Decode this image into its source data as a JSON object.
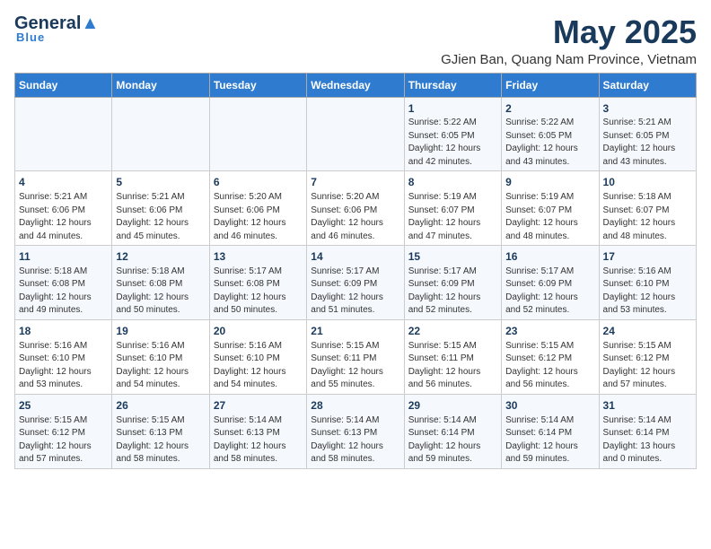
{
  "header": {
    "logo_general": "General",
    "logo_blue": "Blue",
    "logo_sub": "Blue",
    "month_title": "May 2025",
    "location": "GJien Ban, Quang Nam Province, Vietnam"
  },
  "days_of_week": [
    "Sunday",
    "Monday",
    "Tuesday",
    "Wednesday",
    "Thursday",
    "Friday",
    "Saturday"
  ],
  "weeks": [
    [
      {
        "day": "",
        "info": ""
      },
      {
        "day": "",
        "info": ""
      },
      {
        "day": "",
        "info": ""
      },
      {
        "day": "",
        "info": ""
      },
      {
        "day": "1",
        "info": "Sunrise: 5:22 AM\nSunset: 6:05 PM\nDaylight: 12 hours\nand 42 minutes."
      },
      {
        "day": "2",
        "info": "Sunrise: 5:22 AM\nSunset: 6:05 PM\nDaylight: 12 hours\nand 43 minutes."
      },
      {
        "day": "3",
        "info": "Sunrise: 5:21 AM\nSunset: 6:05 PM\nDaylight: 12 hours\nand 43 minutes."
      }
    ],
    [
      {
        "day": "4",
        "info": "Sunrise: 5:21 AM\nSunset: 6:06 PM\nDaylight: 12 hours\nand 44 minutes."
      },
      {
        "day": "5",
        "info": "Sunrise: 5:21 AM\nSunset: 6:06 PM\nDaylight: 12 hours\nand 45 minutes."
      },
      {
        "day": "6",
        "info": "Sunrise: 5:20 AM\nSunset: 6:06 PM\nDaylight: 12 hours\nand 46 minutes."
      },
      {
        "day": "7",
        "info": "Sunrise: 5:20 AM\nSunset: 6:06 PM\nDaylight: 12 hours\nand 46 minutes."
      },
      {
        "day": "8",
        "info": "Sunrise: 5:19 AM\nSunset: 6:07 PM\nDaylight: 12 hours\nand 47 minutes."
      },
      {
        "day": "9",
        "info": "Sunrise: 5:19 AM\nSunset: 6:07 PM\nDaylight: 12 hours\nand 48 minutes."
      },
      {
        "day": "10",
        "info": "Sunrise: 5:18 AM\nSunset: 6:07 PM\nDaylight: 12 hours\nand 48 minutes."
      }
    ],
    [
      {
        "day": "11",
        "info": "Sunrise: 5:18 AM\nSunset: 6:08 PM\nDaylight: 12 hours\nand 49 minutes."
      },
      {
        "day": "12",
        "info": "Sunrise: 5:18 AM\nSunset: 6:08 PM\nDaylight: 12 hours\nand 50 minutes."
      },
      {
        "day": "13",
        "info": "Sunrise: 5:17 AM\nSunset: 6:08 PM\nDaylight: 12 hours\nand 50 minutes."
      },
      {
        "day": "14",
        "info": "Sunrise: 5:17 AM\nSunset: 6:09 PM\nDaylight: 12 hours\nand 51 minutes."
      },
      {
        "day": "15",
        "info": "Sunrise: 5:17 AM\nSunset: 6:09 PM\nDaylight: 12 hours\nand 52 minutes."
      },
      {
        "day": "16",
        "info": "Sunrise: 5:17 AM\nSunset: 6:09 PM\nDaylight: 12 hours\nand 52 minutes."
      },
      {
        "day": "17",
        "info": "Sunrise: 5:16 AM\nSunset: 6:10 PM\nDaylight: 12 hours\nand 53 minutes."
      }
    ],
    [
      {
        "day": "18",
        "info": "Sunrise: 5:16 AM\nSunset: 6:10 PM\nDaylight: 12 hours\nand 53 minutes."
      },
      {
        "day": "19",
        "info": "Sunrise: 5:16 AM\nSunset: 6:10 PM\nDaylight: 12 hours\nand 54 minutes."
      },
      {
        "day": "20",
        "info": "Sunrise: 5:16 AM\nSunset: 6:10 PM\nDaylight: 12 hours\nand 54 minutes."
      },
      {
        "day": "21",
        "info": "Sunrise: 5:15 AM\nSunset: 6:11 PM\nDaylight: 12 hours\nand 55 minutes."
      },
      {
        "day": "22",
        "info": "Sunrise: 5:15 AM\nSunset: 6:11 PM\nDaylight: 12 hours\nand 56 minutes."
      },
      {
        "day": "23",
        "info": "Sunrise: 5:15 AM\nSunset: 6:12 PM\nDaylight: 12 hours\nand 56 minutes."
      },
      {
        "day": "24",
        "info": "Sunrise: 5:15 AM\nSunset: 6:12 PM\nDaylight: 12 hours\nand 57 minutes."
      }
    ],
    [
      {
        "day": "25",
        "info": "Sunrise: 5:15 AM\nSunset: 6:12 PM\nDaylight: 12 hours\nand 57 minutes."
      },
      {
        "day": "26",
        "info": "Sunrise: 5:15 AM\nSunset: 6:13 PM\nDaylight: 12 hours\nand 58 minutes."
      },
      {
        "day": "27",
        "info": "Sunrise: 5:14 AM\nSunset: 6:13 PM\nDaylight: 12 hours\nand 58 minutes."
      },
      {
        "day": "28",
        "info": "Sunrise: 5:14 AM\nSunset: 6:13 PM\nDaylight: 12 hours\nand 58 minutes."
      },
      {
        "day": "29",
        "info": "Sunrise: 5:14 AM\nSunset: 6:14 PM\nDaylight: 12 hours\nand 59 minutes."
      },
      {
        "day": "30",
        "info": "Sunrise: 5:14 AM\nSunset: 6:14 PM\nDaylight: 12 hours\nand 59 minutes."
      },
      {
        "day": "31",
        "info": "Sunrise: 5:14 AM\nSunset: 6:14 PM\nDaylight: 13 hours\nand 0 minutes."
      }
    ]
  ]
}
